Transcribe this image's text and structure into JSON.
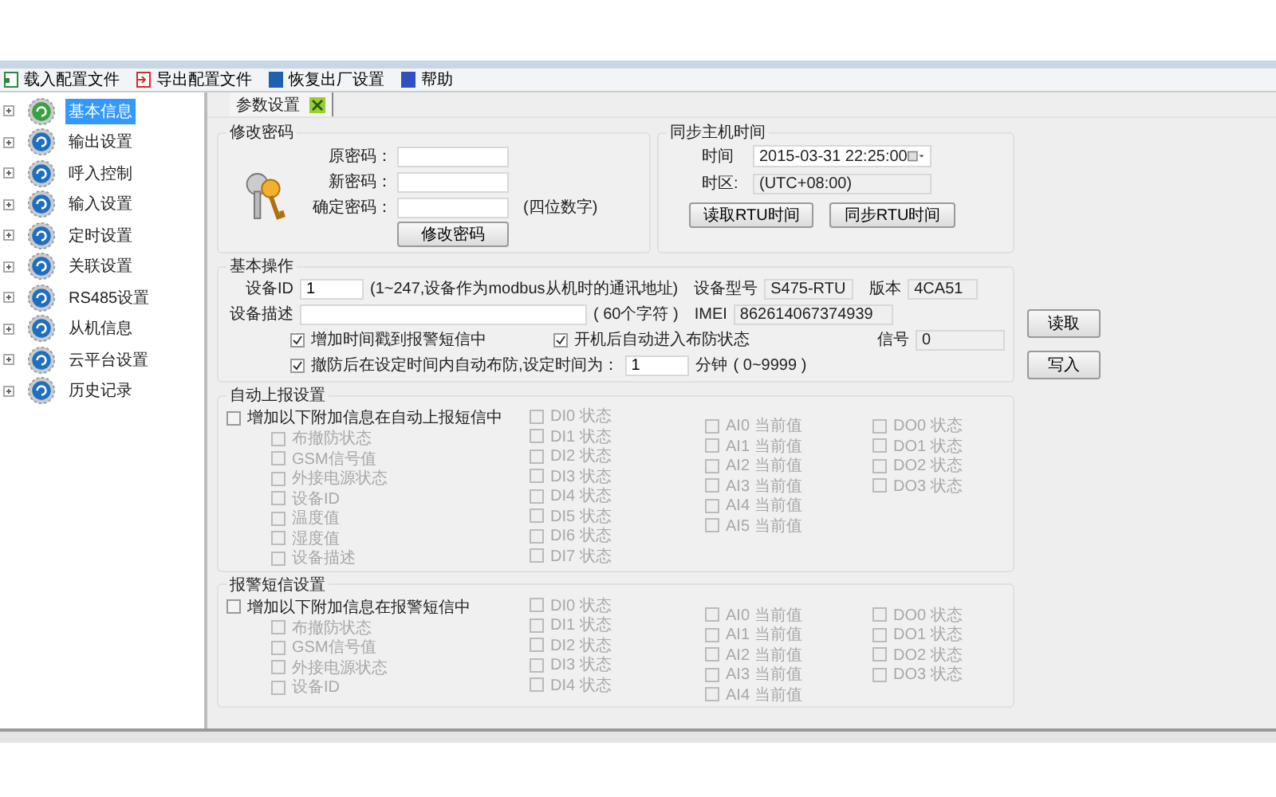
{
  "toolbar": [
    {
      "label": "载入配置文件",
      "kind": "load"
    },
    {
      "label": "导出配置文件",
      "kind": "export"
    },
    {
      "label": "恢复出厂设置",
      "kind": "restore"
    },
    {
      "label": "帮助",
      "kind": "help"
    }
  ],
  "sidebar": {
    "items": [
      {
        "label": "基本信息",
        "selected": true
      },
      {
        "label": "输出设置",
        "selected": false
      },
      {
        "label": "呼入控制",
        "selected": false
      },
      {
        "label": "输入设置",
        "selected": false
      },
      {
        "label": "定时设置",
        "selected": false
      },
      {
        "label": "关联设置",
        "selected": false
      },
      {
        "label": "RS485设置",
        "selected": false
      },
      {
        "label": "从机信息",
        "selected": false
      },
      {
        "label": "云平台设置",
        "selected": false
      },
      {
        "label": "历史记录",
        "selected": false
      }
    ]
  },
  "tabs": [
    {
      "label": "参数设置",
      "selected": true
    }
  ],
  "password": {
    "title": "修改密码",
    "fields": [
      {
        "label": "原密码："
      },
      {
        "label": "新密码："
      },
      {
        "label": "确定密码："
      }
    ],
    "note": "(四位数字)",
    "button": "修改密码"
  },
  "sync_time": {
    "title": "同步主机时间",
    "time_label": "时间",
    "time_value": "2015-03-31 22:25:00",
    "timezone_label": "时区:",
    "timezone_value": "(UTC+08:00)",
    "buttons": [
      "读取RTU时间",
      "同步RTU时间"
    ]
  },
  "basic": {
    "title": "基本操作",
    "device_id_label": "设备ID",
    "device_id": "1",
    "device_id_hint": "(1~247,设备作为modbus从机时的通讯地址)",
    "model_label": "设备型号",
    "model": "S475-RTU",
    "version_label": "版本",
    "version": "4CA51",
    "desc_label": "设备描述",
    "desc_hint": "( 60个字符 )",
    "imei_label": "IMEI",
    "imei": "862614067374939",
    "signal_label": "信号",
    "signal": "0",
    "checkboxes": [
      {
        "label": "增加时间戳到报警短信中",
        "checked": true
      },
      {
        "label": "开机后自动进入布防状态",
        "checked": true
      },
      {
        "label": "撤防后在设定时间内自动布防,设定时间为：",
        "checked": true
      }
    ],
    "delay": "1",
    "delay_unit": "分钟",
    "delay_range": "( 0~9999 )"
  },
  "side_buttons": [
    "读取",
    "写入"
  ],
  "auto_report": {
    "title": "自动上报设置",
    "master": {
      "label": "增加以下附加信息在自动上报短信中",
      "checked": false
    },
    "columns": [
      [
        {
          "label": "布撤防状态",
          "checked": false,
          "disabled": true
        },
        {
          "label": "GSM信号值",
          "checked": false,
          "disabled": true
        },
        {
          "label": "外接电源状态",
          "checked": false,
          "disabled": true
        },
        {
          "label": "设备ID",
          "checked": false,
          "disabled": true
        },
        {
          "label": "温度值",
          "checked": false,
          "disabled": true
        },
        {
          "label": "湿度值",
          "checked": false,
          "disabled": true
        },
        {
          "label": "设备描述",
          "checked": false,
          "disabled": true
        }
      ],
      [
        {
          "label": "DI0 状态",
          "checked": false,
          "disabled": true
        },
        {
          "label": "DI1 状态",
          "checked": false,
          "disabled": true
        },
        {
          "label": "DI2 状态",
          "checked": false,
          "disabled": true
        },
        {
          "label": "DI3 状态",
          "checked": false,
          "disabled": true
        },
        {
          "label": "DI4 状态",
          "checked": false,
          "disabled": true
        },
        {
          "label": "DI5 状态",
          "checked": false,
          "disabled": true
        },
        {
          "label": "DI6 状态",
          "checked": false,
          "disabled": true
        },
        {
          "label": "DI7 状态",
          "checked": false,
          "disabled": true
        }
      ],
      [
        {
          "label": "AI0 当前值",
          "checked": false,
          "disabled": true
        },
        {
          "label": "AI1 当前值",
          "checked": false,
          "disabled": true
        },
        {
          "label": "AI2 当前值",
          "checked": false,
          "disabled": true
        },
        {
          "label": "AI3 当前值",
          "checked": false,
          "disabled": true
        },
        {
          "label": "AI4 当前值",
          "checked": false,
          "disabled": true
        },
        {
          "label": "AI5 当前值",
          "checked": false,
          "disabled": true
        }
      ],
      [
        {
          "label": "DO0 状态",
          "checked": false,
          "disabled": true
        },
        {
          "label": "DO1 状态",
          "checked": false,
          "disabled": true
        },
        {
          "label": "DO2 状态",
          "checked": false,
          "disabled": true
        },
        {
          "label": "DO3 状态",
          "checked": false,
          "disabled": true
        }
      ]
    ]
  },
  "alarm_sms": {
    "title": "报警短信设置",
    "master": {
      "label": "增加以下附加信息在报警短信中",
      "checked": false
    },
    "columns": [
      [
        {
          "label": "布撤防状态",
          "checked": false,
          "disabled": true
        },
        {
          "label": "GSM信号值",
          "checked": false,
          "disabled": true
        },
        {
          "label": "外接电源状态",
          "checked": false,
          "disabled": true
        },
        {
          "label": "设备ID",
          "checked": false,
          "disabled": true
        }
      ],
      [
        {
          "label": "DI0 状态",
          "checked": false,
          "disabled": true
        },
        {
          "label": "DI1 状态",
          "checked": false,
          "disabled": true
        },
        {
          "label": "DI2 状态",
          "checked": false,
          "disabled": true
        },
        {
          "label": "DI3 状态",
          "checked": false,
          "disabled": true
        },
        {
          "label": "DI4 状态",
          "checked": false,
          "disabled": true
        }
      ],
      [
        {
          "label": "AI0 当前值",
          "checked": false,
          "disabled": true
        },
        {
          "label": "AI1 当前值",
          "checked": false,
          "disabled": true
        },
        {
          "label": "AI2 当前值",
          "checked": false,
          "disabled": true
        },
        {
          "label": "AI3 当前值",
          "checked": false,
          "disabled": true
        },
        {
          "label": "AI4 当前值",
          "checked": false,
          "disabled": true
        }
      ],
      [
        {
          "label": "DO0 状态",
          "checked": false,
          "disabled": true
        },
        {
          "label": "DO1 状态",
          "checked": false,
          "disabled": true
        },
        {
          "label": "DO2 状态",
          "checked": false,
          "disabled": true
        },
        {
          "label": "DO3 状态",
          "checked": false,
          "disabled": true
        }
      ]
    ]
  }
}
